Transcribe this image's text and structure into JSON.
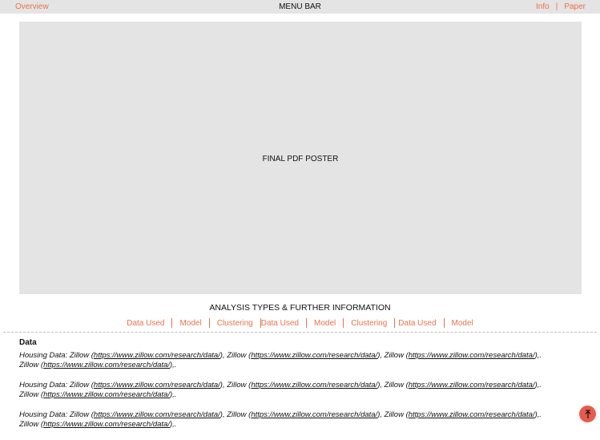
{
  "menubar": {
    "left_link": "Overview",
    "title": "MENU BAR",
    "right_links": [
      "Info",
      "Paper"
    ],
    "separator": "|"
  },
  "poster": {
    "label": "FINAL PDF POSTER"
  },
  "section": {
    "heading": "ANALYSIS TYPES & FURTHER INFORMATION",
    "tabs": [
      "Data Used",
      "Model",
      "Clustering",
      "Data Used",
      "Model",
      "Clustering",
      "Data Used",
      "Model"
    ]
  },
  "data_section": {
    "heading": "Data",
    "paragraphs": [
      {
        "prefix": "Housing Data: Zillow (",
        "link1": "https://www.zillow.com/research/data/",
        "mid1": "), Zillow (",
        "link2": "https://www.zillow.com/research/data/",
        "mid2": "), Zillow (",
        "link3": "https://www.zillow.com/research/data/",
        "mid3": "),. Zillow (",
        "link4": "https://www.zillow.com/research/data/",
        "suffix": "),."
      },
      {
        "prefix": "Housing Data: Zillow (",
        "link1": "https://www.zillow.com/research/data/",
        "mid1": "), Zillow (",
        "link2": "https://www.zillow.com/research/data/",
        "mid2": "), Zillow (",
        "link3": "https://www.zillow.com/research/data/",
        "mid3": "),. Zillow (",
        "link4": "https://www.zillow.com/research/data/",
        "suffix": "),."
      },
      {
        "prefix": "Housing Data: Zillow (",
        "link1": "https://www.zillow.com/research/data/",
        "mid1": "), Zillow (",
        "link2": "https://www.zillow.com/research/data/",
        "mid2": "), Zillow (",
        "link3": "https://www.zillow.com/research/data/",
        "mid3": "),. Zillow (",
        "link4": "https://www.zillow.com/research/data/",
        "suffix": "),."
      }
    ]
  },
  "scroll_top": {
    "icon": "arrow-up-icon"
  },
  "colors": {
    "accent": "#e8734a",
    "menubar_bg": "#e4e4e4",
    "poster_bg": "#e4e4e4",
    "top_button_bg": "#e85a4f"
  }
}
